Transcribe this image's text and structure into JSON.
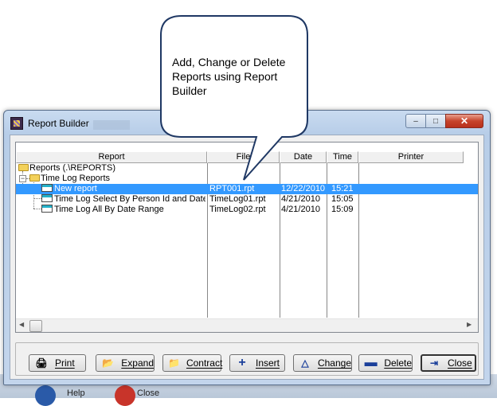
{
  "background": {
    "help_label": "Help",
    "close_label": "Close"
  },
  "window": {
    "title": "Report Builder",
    "controls": {
      "minimize": "–",
      "maximize": "□",
      "close": "✕"
    }
  },
  "callout": {
    "text": "Add, Change or Delete Reports using Report Builder"
  },
  "columns": [
    {
      "label": "Report"
    },
    {
      "label": "File"
    },
    {
      "label": "Date"
    },
    {
      "label": "Time"
    },
    {
      "label": "Printer"
    }
  ],
  "tree": {
    "root": {
      "label": "Reports (.\\REPORTS)"
    },
    "group": {
      "label": "Time Log Reports"
    },
    "items": [
      {
        "name": "New report",
        "file": "RPT001.rpt",
        "date": "12/22/2010",
        "time": "15:21",
        "printer": "",
        "selected": true
      },
      {
        "name": "Time Log Select By Person Id and Date Range",
        "file": "TimeLog01.rpt",
        "date": "4/21/2010",
        "time": "15:05",
        "printer": ""
      },
      {
        "name": "Time Log All By Date Range",
        "file": "TimeLog02.rpt",
        "date": "4/21/2010",
        "time": "15:09",
        "printer": ""
      }
    ]
  },
  "buttons": {
    "print": "Print",
    "expand": "Expand",
    "contract": "Contract",
    "insert": "Insert",
    "change": "Change",
    "delete": "Delete",
    "close": "Close"
  },
  "colors": {
    "selection": "#3399ff",
    "title_gradient": "#b7cde8",
    "close_red": "#c7432b"
  }
}
